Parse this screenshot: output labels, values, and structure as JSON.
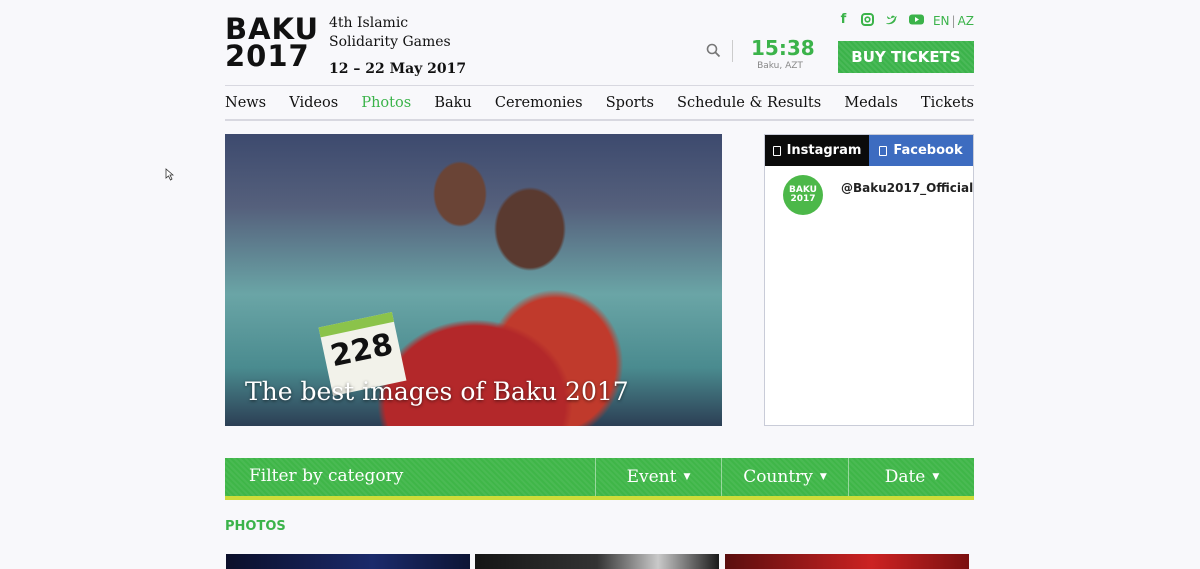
{
  "logo": {
    "line1": "BAKU",
    "line2": "2017"
  },
  "header": {
    "games_line1": "4th Islamic",
    "games_line2": "Solidarity Games",
    "dates": "12 – 22 May 2017",
    "lang_en": "EN",
    "lang_sep": "|",
    "lang_az": "AZ",
    "time": "15:38",
    "timezone": "Baku, AZT",
    "buy_label": "BUY TICKETS",
    "social_icons": [
      "facebook-icon",
      "instagram-icon",
      "twitter-icon",
      "youtube-icon"
    ]
  },
  "nav": {
    "items": [
      "News",
      "Videos",
      "Photos",
      "Baku",
      "Ceremonies",
      "Sports",
      "Schedule & Results",
      "Medals",
      "Tickets"
    ],
    "active": "Photos"
  },
  "hero": {
    "title": "The best images of Baku 2017",
    "bib_number": "228"
  },
  "social_box": {
    "tab_instagram": "Instagram",
    "tab_facebook": "Facebook",
    "avatar_text": "BAKU 2017",
    "handle": "@Baku2017_Official"
  },
  "filter": {
    "label": "Filter by category",
    "event": "Event",
    "country": "Country",
    "date": "Date"
  },
  "section_label": "PHOTOS",
  "colors": {
    "accent": "#3bb34a",
    "facebook": "#3d6cc0",
    "underline": "#cddc39"
  }
}
